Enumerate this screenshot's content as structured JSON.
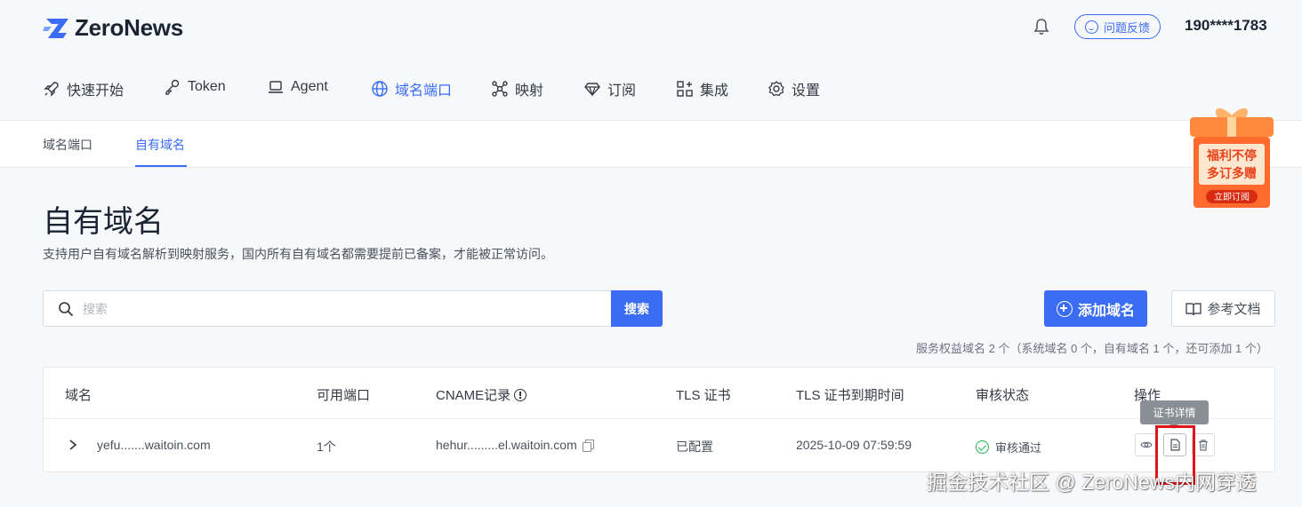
{
  "brand": {
    "name": "ZeroNews",
    "accent": "#3a6cf4"
  },
  "header": {
    "feedback_label": "问题反馈",
    "user_phone": "190****1783"
  },
  "main_nav": [
    {
      "label": "快速开始",
      "icon": "rocket-icon"
    },
    {
      "label": "Token",
      "icon": "key-icon"
    },
    {
      "label": "Agent",
      "icon": "laptop-icon"
    },
    {
      "label": "域名端口",
      "icon": "globe-icon",
      "active": true
    },
    {
      "label": "映射",
      "icon": "nodes-icon"
    },
    {
      "label": "订阅",
      "icon": "diamond-icon"
    },
    {
      "label": "集成",
      "icon": "apps-icon"
    },
    {
      "label": "设置",
      "icon": "gear-icon"
    }
  ],
  "sub_tabs": [
    {
      "label": "域名端口"
    },
    {
      "label": "自有域名",
      "active": true
    }
  ],
  "promo": {
    "line1": "福利不停",
    "line2": "多订多赠",
    "button": "立即订阅"
  },
  "page": {
    "title": "自有域名",
    "description": "支持用户自有域名解析到映射服务，国内所有自有域名都需要提前已备案，才能被正常访问。"
  },
  "search": {
    "placeholder": "搜索",
    "button_label": "搜索"
  },
  "actions": {
    "add_label": "添加域名",
    "docs_label": "参考文档"
  },
  "quota_text": "服务权益域名 2 个（系统域名 0 个，自有域名 1 个，还可添加 1 个）",
  "table": {
    "headers": [
      "域名",
      "可用端口",
      "CNAME记录",
      "TLS 证书",
      "TLS 证书到期时间",
      "审核状态",
      "操作"
    ],
    "rows": [
      {
        "domain": "yefu.......waitoin.com",
        "ports": "1个",
        "cname": "hehur.........el.waitoin.com",
        "tls": "已配置",
        "expiry": "2025-10-09 07:59:59",
        "status": "审核通过"
      }
    ]
  },
  "tooltip": "证书详情",
  "watermark": "掘金技术社区 @ ZeroNews内网穿透"
}
